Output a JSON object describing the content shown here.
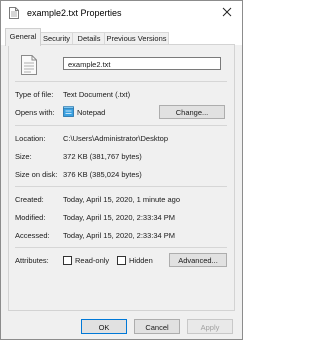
{
  "window": {
    "title": "example2.txt Properties",
    "title_icon": "text-file-icon",
    "close_icon": "close-icon"
  },
  "tabs": [
    {
      "label": "General",
      "active": true
    },
    {
      "label": "Security",
      "active": false
    },
    {
      "label": "Details",
      "active": false
    },
    {
      "label": "Previous Versions",
      "active": false
    }
  ],
  "file": {
    "icon": "text-document-icon",
    "name": "example2.txt"
  },
  "type_section": {
    "type_label": "Type of file:",
    "type_value": "Text Document (.txt)",
    "opens_label": "Opens with:",
    "opens_icon": "notepad-icon",
    "opens_value": "Notepad",
    "change_button": "Change..."
  },
  "location_section": {
    "location_label": "Location:",
    "location_value": "C:\\Users\\Administrator\\Desktop",
    "size_label": "Size:",
    "size_value": "372 KB (381,767 bytes)",
    "size_on_disk_label": "Size on disk:",
    "size_on_disk_value": "376 KB (385,024 bytes)"
  },
  "dates_section": {
    "created_label": "Created:",
    "created_value": "Today, April 15, 2020, 1 minute ago",
    "modified_label": "Modified:",
    "modified_value": "Today, April 15, 2020, 2:33:34 PM",
    "accessed_label": "Accessed:",
    "accessed_value": "Today, April 15, 2020, 2:33:34 PM"
  },
  "attributes": {
    "label": "Attributes:",
    "readonly_label": "Read-only",
    "readonly_checked": false,
    "hidden_label": "Hidden",
    "hidden_checked": false,
    "advanced_button": "Advanced..."
  },
  "footer": {
    "ok": "OK",
    "cancel": "Cancel",
    "apply": "Apply"
  },
  "colors": {
    "focus_border": "#0078d7",
    "notepad_blue": "#3aa0e0"
  }
}
